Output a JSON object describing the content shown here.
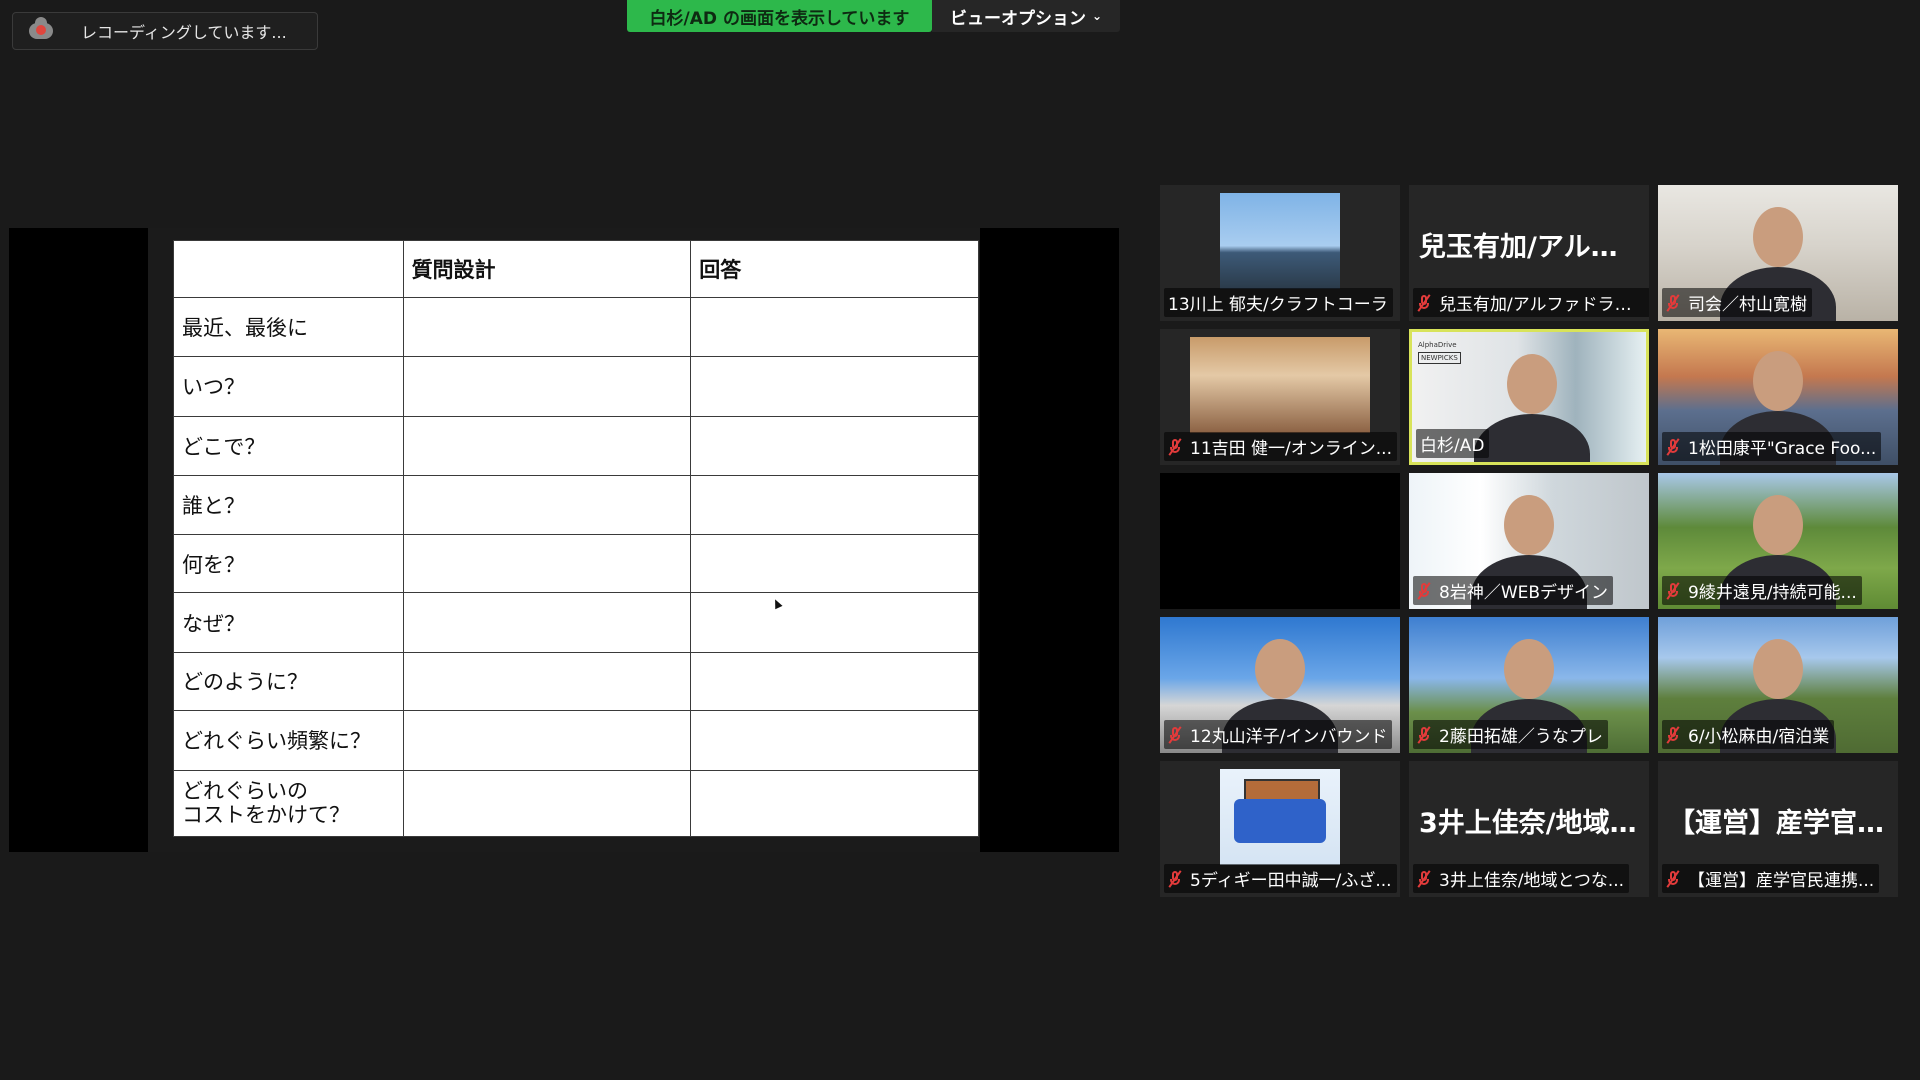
{
  "recording": {
    "text": "レコーディングしています..."
  },
  "banner": {
    "sharing_text": "白杉/AD の画面を表示しています",
    "view_options": "ビューオプション"
  },
  "slide_table": {
    "headers": [
      "",
      "質問設計",
      "回答"
    ],
    "rows": [
      [
        "最近、最後に",
        "",
        ""
      ],
      [
        "いつ？",
        "",
        ""
      ],
      [
        "どこで？",
        "",
        ""
      ],
      [
        "誰と？",
        "",
        ""
      ],
      [
        "何を？",
        "",
        ""
      ],
      [
        "なぜ？",
        "",
        ""
      ],
      [
        "どのように？",
        "",
        ""
      ],
      [
        "どれぐらい頻繁に？",
        "",
        ""
      ],
      [
        "どれぐらいの\nコストをかけて？",
        "",
        ""
      ]
    ]
  },
  "participants": [
    {
      "name": "13川上 郁夫/クラフトコーラ",
      "muted": false,
      "type": "thumb",
      "scene": "sea"
    },
    {
      "name": "兒玉有加/アルファドライ...",
      "big_name": "兒玉有加/アルフ...",
      "muted": true,
      "type": "name"
    },
    {
      "name": "司会／村山寛樹",
      "muted": true,
      "type": "video",
      "scene": "office"
    },
    {
      "name": "11吉田 健一/オンライン...",
      "muted": true,
      "type": "thumb",
      "scene": "room"
    },
    {
      "name": "白杉/AD",
      "muted": false,
      "type": "video",
      "scene": "presenter",
      "active": true,
      "slide_brand": "AlphaDrive",
      "slide_tag": "NEWPICKS"
    },
    {
      "name": "1松田康平\"Grace Foo...",
      "muted": true,
      "type": "video",
      "scene": "bridge"
    },
    {
      "name": "",
      "muted": false,
      "type": "black"
    },
    {
      "name": "8岩神／WEBデザイン",
      "muted": true,
      "type": "video",
      "scene": "window"
    },
    {
      "name": "9綾井遠見/持続可能...",
      "muted": true,
      "type": "video",
      "scene": "field"
    },
    {
      "name": "12丸山洋子/インバウンド",
      "muted": true,
      "type": "video",
      "scene": "flags"
    },
    {
      "name": "2藤田拓雄／うなプレ",
      "muted": true,
      "type": "video",
      "scene": "building"
    },
    {
      "name": "6/小松麻由/宿泊業",
      "muted": true,
      "type": "video",
      "scene": "thatch"
    },
    {
      "name": "5ディギー田中誠一/ふざ...",
      "muted": true,
      "type": "thumb",
      "scene": "truck"
    },
    {
      "name": "3井上佳奈/地域とつな...",
      "big_name": "3井上佳奈/地域...",
      "muted": true,
      "type": "name"
    },
    {
      "name": "【運営】産学官民連携...",
      "big_name": "【運営】産学官民...",
      "muted": true,
      "type": "name"
    }
  ]
}
